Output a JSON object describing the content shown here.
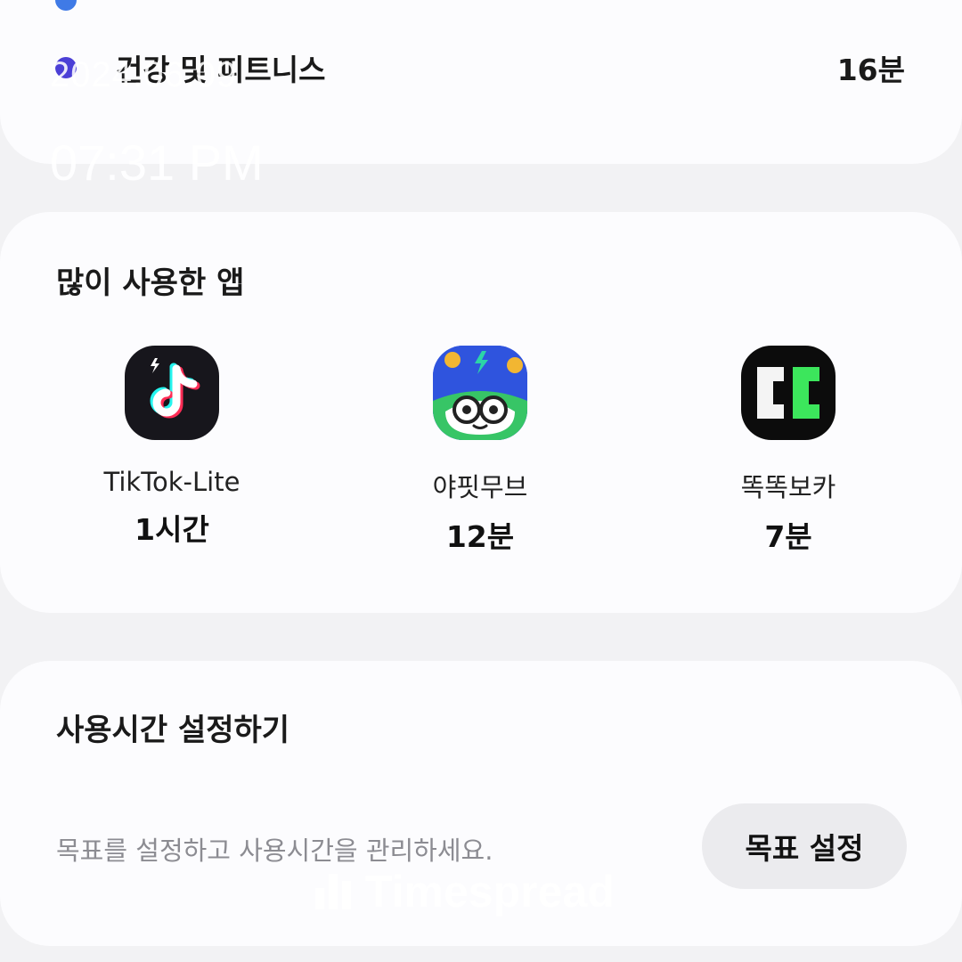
{
  "categories": [
    {
      "name": "",
      "time": "",
      "color": "#3f7ae6"
    },
    {
      "name": "건강 및 피트니스",
      "time": "16분",
      "color": "#4b3fd6"
    }
  ],
  "overlay": {
    "date": "2024.06.09",
    "time": "07:31 PM"
  },
  "top_apps": {
    "title": "많이 사용한 앱",
    "apps": [
      {
        "name": "TikTok-Lite",
        "time": "1시간",
        "icon": "tiktok-lite-app-icon"
      },
      {
        "name": "야핏무브",
        "time": "12분",
        "icon": "yafit-move-app-icon"
      },
      {
        "name": "똑똑보카",
        "time": "7분",
        "icon": "ttokttok-boca-app-icon"
      }
    ]
  },
  "goal": {
    "title": "사용시간 설정하기",
    "description": "목표를 설정하고 사용시간을 관리하세요.",
    "button_label": "목표 설정"
  },
  "watermark": {
    "text": "Timespread"
  }
}
